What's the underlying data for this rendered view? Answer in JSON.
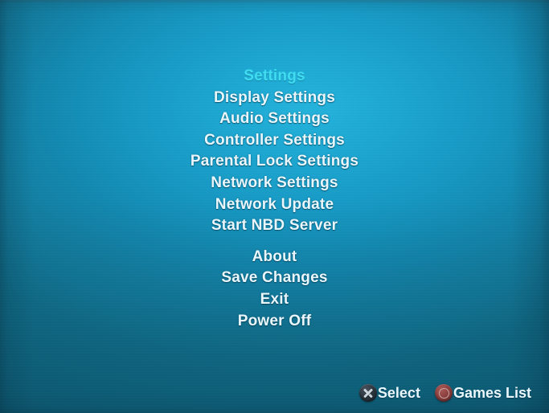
{
  "screen": {
    "title": "Settings",
    "background": {
      "base_color": "#1590b8",
      "highlight_color": "#23b4dd",
      "shadow_color": "#10728f"
    }
  },
  "menu": {
    "selected_index": 0,
    "text_color": "#e9f7fd",
    "selected_color": "#3fdcf2",
    "groups": [
      {
        "name": "settings-group",
        "items": [
          {
            "label": "Settings",
            "selected": true
          },
          {
            "label": "Display Settings",
            "selected": false
          },
          {
            "label": "Audio Settings",
            "selected": false
          },
          {
            "label": "Controller Settings",
            "selected": false
          },
          {
            "label": "Parental Lock Settings",
            "selected": false
          },
          {
            "label": "Network Settings",
            "selected": false
          },
          {
            "label": "Network Update",
            "selected": false
          },
          {
            "label": "Start NBD Server",
            "selected": false
          }
        ]
      },
      {
        "name": "system-group",
        "items": [
          {
            "label": "About",
            "selected": false
          },
          {
            "label": "Save Changes",
            "selected": false
          },
          {
            "label": "Exit",
            "selected": false
          },
          {
            "label": "Power Off",
            "selected": false
          }
        ]
      }
    ]
  },
  "footer": {
    "prompts": [
      {
        "icon": "cross-button-icon",
        "icon_color": "#2b333d",
        "label": "Select"
      },
      {
        "icon": "circle-button-icon",
        "icon_color": "#8c403e",
        "label": "Games List"
      }
    ]
  }
}
